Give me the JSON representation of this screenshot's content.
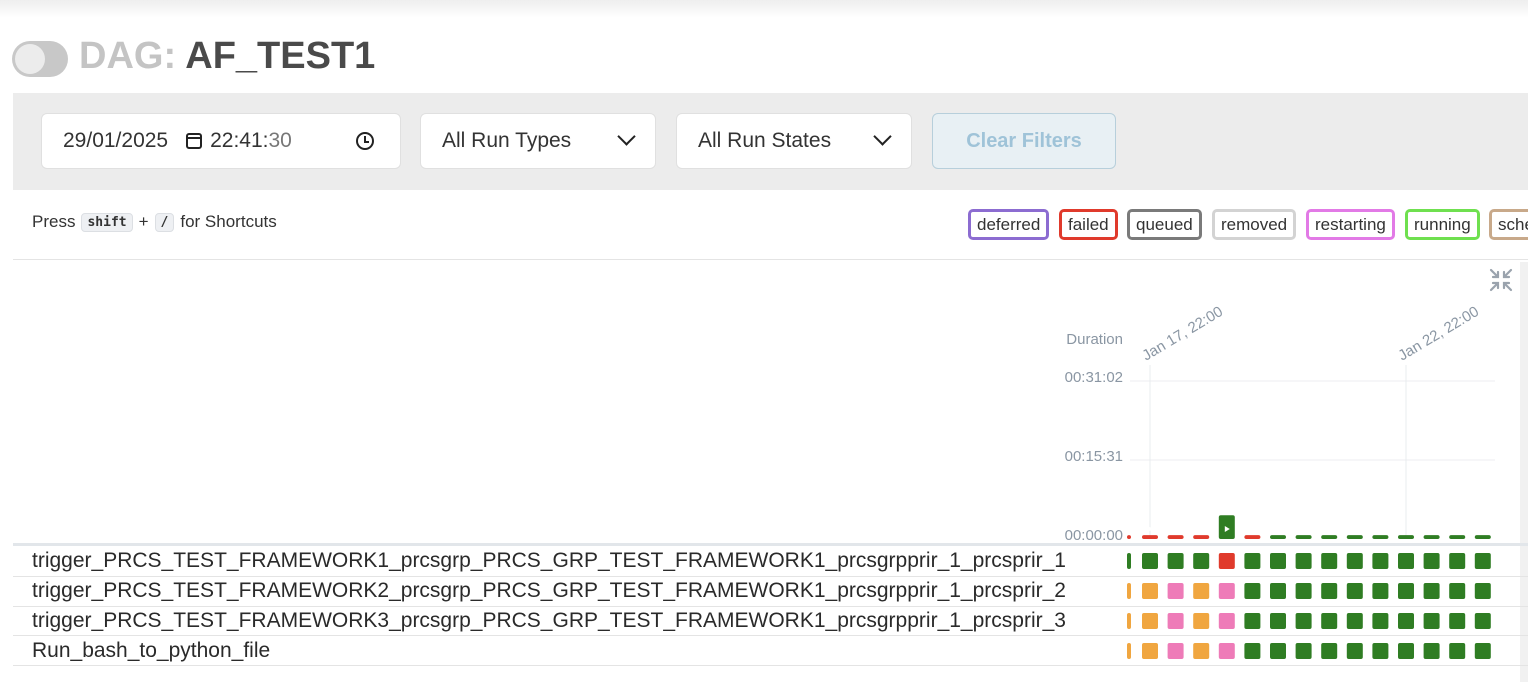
{
  "header": {
    "toggle_state": "off",
    "title_prefix": "DAG:",
    "dag_name": "AF_TEST1"
  },
  "filters": {
    "date": "29/01/2025",
    "time_hm": "22:41:",
    "time_s": "30",
    "run_types": "All Run Types",
    "run_states": "All Run States",
    "clear_label": "Clear Filters"
  },
  "shortcut_hint": {
    "press": "Press",
    "key1": "shift",
    "plus": "+",
    "key2": "/",
    "suffix": "for Shortcuts"
  },
  "legend": [
    {
      "label": "deferred",
      "color": "#8c6cd1"
    },
    {
      "label": "failed",
      "color": "#e03a2c"
    },
    {
      "label": "queued",
      "color": "#7a7a7a"
    },
    {
      "label": "removed",
      "color": "#d3d3d3"
    },
    {
      "label": "restarting",
      "color": "#e27ae6"
    },
    {
      "label": "running",
      "color": "#6fe04f"
    },
    {
      "label": "sche",
      "color": "#c8a98a"
    }
  ],
  "chart_data": {
    "type": "bar",
    "ylabel": "Duration",
    "y_ticks": [
      "00:31:02",
      "00:15:31",
      "00:00:00"
    ],
    "ylim": [
      0,
      1862
    ],
    "x_ticks": [
      {
        "label": "Jan 17, 22:00",
        "run_index": 1
      },
      {
        "label": "Jan 22, 22:00",
        "run_index": 11
      }
    ],
    "runs": [
      {
        "state": "failed",
        "duration_s": 45,
        "partial": true
      },
      {
        "state": "failed",
        "duration_s": 45
      },
      {
        "state": "failed",
        "duration_s": 45
      },
      {
        "state": "failed",
        "duration_s": 45
      },
      {
        "state": "success",
        "duration_s": 280
      },
      {
        "state": "failed",
        "duration_s": 45
      },
      {
        "state": "success",
        "duration_s": 45
      },
      {
        "state": "success",
        "duration_s": 45
      },
      {
        "state": "success",
        "duration_s": 45
      },
      {
        "state": "success",
        "duration_s": 45
      },
      {
        "state": "success",
        "duration_s": 45
      },
      {
        "state": "success",
        "duration_s": 45
      },
      {
        "state": "success",
        "duration_s": 45
      },
      {
        "state": "success",
        "duration_s": 45
      },
      {
        "state": "success",
        "duration_s": 45
      }
    ]
  },
  "colors": {
    "success": "#2f7d23",
    "failed": "#e03a2c",
    "upstream_failed": "#f0a640",
    "up_for_retry": "#ee7bb8"
  },
  "tasks": [
    {
      "name": "trigger_PRCS_TEST_FRAMEWORK1_prcsgrp_PRCS_GRP_TEST_FRAMEWORK1_prcsgrpprir_1_prcsprir_1",
      "cells": [
        "success",
        "success",
        "success",
        "success",
        "failed",
        "success",
        "success",
        "success",
        "success",
        "success",
        "success",
        "success",
        "success",
        "success",
        "success"
      ]
    },
    {
      "name": "trigger_PRCS_TEST_FRAMEWORK2_prcsgrp_PRCS_GRP_TEST_FRAMEWORK1_prcsgrpprir_1_prcsprir_2",
      "cells": [
        "upstream_failed",
        "upstream_failed",
        "up_for_retry",
        "upstream_failed",
        "up_for_retry",
        "success",
        "success",
        "success",
        "success",
        "success",
        "success",
        "success",
        "success",
        "success",
        "success"
      ]
    },
    {
      "name": "trigger_PRCS_TEST_FRAMEWORK3_prcsgrp_PRCS_GRP_TEST_FRAMEWORK1_prcsgrpprir_1_prcsprir_3",
      "cells": [
        "upstream_failed",
        "upstream_failed",
        "up_for_retry",
        "upstream_failed",
        "up_for_retry",
        "success",
        "success",
        "success",
        "success",
        "success",
        "success",
        "success",
        "success",
        "success",
        "success"
      ]
    },
    {
      "name": "Run_bash_to_python_file",
      "cells": [
        "upstream_failed",
        "upstream_failed",
        "up_for_retry",
        "upstream_failed",
        "up_for_retry",
        "success",
        "success",
        "success",
        "success",
        "success",
        "success",
        "success",
        "success",
        "success",
        "success"
      ]
    }
  ]
}
